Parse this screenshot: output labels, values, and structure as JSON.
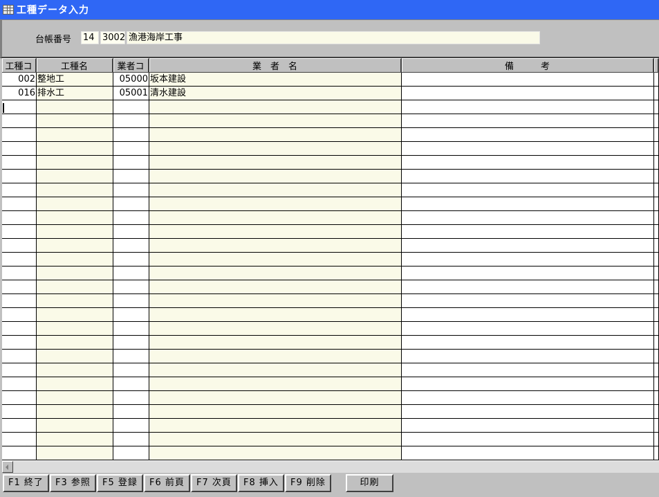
{
  "window": {
    "title": "工種データ入力",
    "icon": "table-icon"
  },
  "header": {
    "ledger_label": "台帳番号",
    "ledger_no_1": "14",
    "ledger_no_2": "3002",
    "project_name": "漁港海岸工事"
  },
  "grid": {
    "columns": [
      "工種コ",
      "工種名",
      "業者コ",
      "業　者　名",
      "備　　　考",
      ""
    ],
    "rows": [
      {
        "work_code": "002",
        "work_name": "整地工",
        "vendor_code": "05000",
        "vendor_name": "坂本建設",
        "note": ""
      },
      {
        "work_code": "016",
        "work_name": "排水工",
        "vendor_code": "05001",
        "vendor_name": "清水建設",
        "note": ""
      }
    ],
    "empty_row_count": 26
  },
  "function_keys": {
    "f1": "F1 終了",
    "f3": "F3 参照",
    "f5": "F5 登録",
    "f6": "F6 前頁",
    "f7": "F7 次頁",
    "f8": "F8 挿入",
    "f9": "F9 削除",
    "print": "印刷"
  },
  "colors": {
    "titlebar": "#2f67f5",
    "face": "#c0c0c0",
    "input_tint": "#fafae8"
  }
}
